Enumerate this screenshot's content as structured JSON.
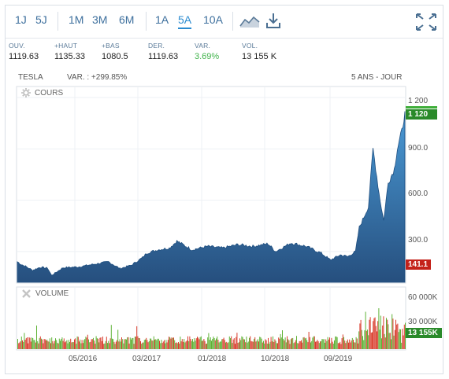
{
  "toolbar": {
    "period_buttons": [
      "1J",
      "5J",
      "1M",
      "3M",
      "6M",
      "1A",
      "5A",
      "10A"
    ],
    "active_period": "5A"
  },
  "stats": [
    {
      "label": "OUV.",
      "value": "1119.63"
    },
    {
      "label": "+HAUT",
      "value": "1135.33"
    },
    {
      "label": "+BAS",
      "value": "1080.5"
    },
    {
      "label": "DER.",
      "value": "1119.63"
    },
    {
      "label": "VAR.",
      "value": "3.69%"
    },
    {
      "label": "VOL.",
      "value": "13 155 K"
    }
  ],
  "chart_header": {
    "symbol": "TESLA",
    "variation": "VAR. : +299.85%",
    "range": "5 ANS - JOUR"
  },
  "price_panel": {
    "label": "COURS",
    "y_ticks": [
      "1 200",
      "900.0",
      "600.0",
      "300.0"
    ],
    "last_badge": "1 120",
    "low_badge": "141.1"
  },
  "volume_panel": {
    "label": "VOLUME",
    "y_ticks": [
      "60 000K",
      "30 000K"
    ],
    "last_badge": "13 155K"
  },
  "x_ticks": [
    "05/2016",
    "03/2017",
    "01/2018",
    "10/2018",
    "09/2019"
  ],
  "colors": {
    "accent": "#2a8bd0",
    "area_top": "#3a86c4",
    "area_bottom": "#2a5a8c",
    "up": "#5fb236",
    "down": "#d93b2b",
    "positive_text": "#3fb34a"
  },
  "chart_data": [
    {
      "type": "area",
      "title": "COURS",
      "ylim": [
        120,
        1260
      ],
      "x": [
        0,
        5,
        12,
        20,
        30,
        40,
        45,
        60,
        80,
        100,
        120,
        135,
        150,
        165,
        170,
        185,
        200,
        210,
        230,
        250,
        270,
        290,
        310,
        330,
        340,
        360,
        380,
        400,
        412,
        425,
        435,
        445,
        450,
        462,
        468,
        470,
        476,
        482,
        488,
        492,
        496,
        500,
        506,
        510
      ],
      "values": [
        240,
        225,
        210,
        190,
        208,
        202,
        160,
        205,
        210,
        225,
        240,
        200,
        220,
        265,
        290,
        310,
        320,
        360,
        310,
        330,
        320,
        340,
        330,
        345,
        300,
        350,
        330,
        290,
        250,
        280,
        270,
        300,
        440,
        560,
        900,
        840,
        640,
        480,
        700,
        740,
        780,
        900,
        1000,
        1120
      ],
      "grid": true
    },
    {
      "type": "bar",
      "title": "VOLUME",
      "ylim": [
        0,
        70000
      ],
      "last": 13155
    }
  ]
}
